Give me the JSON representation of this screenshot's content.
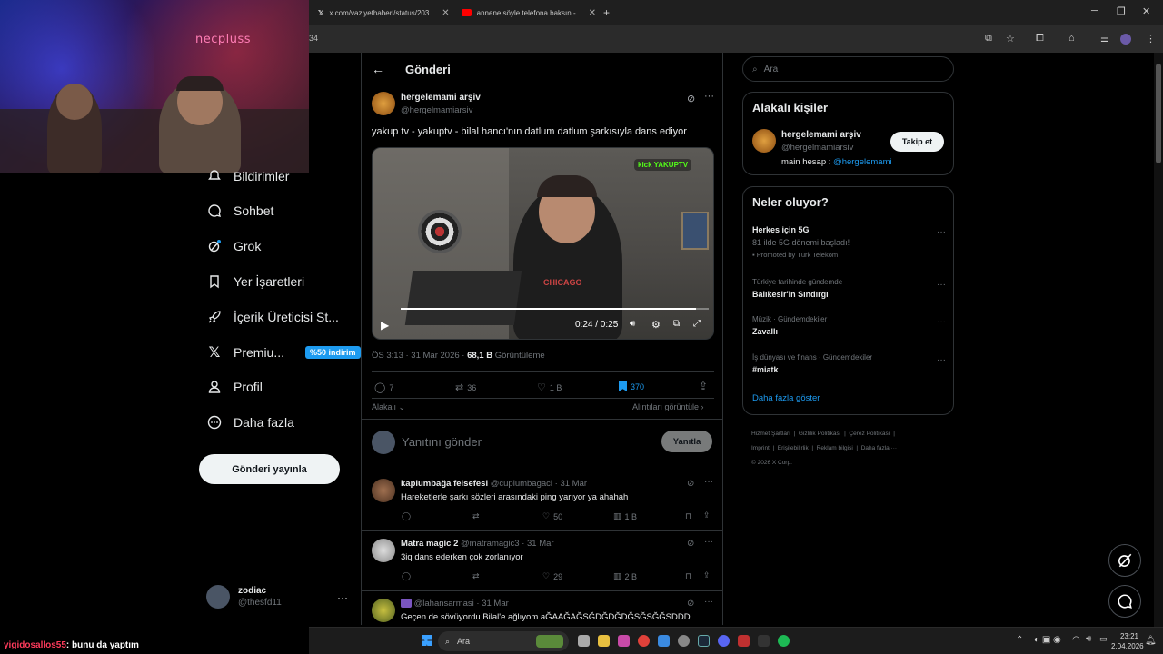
{
  "browser": {
    "tabs": [
      {
        "label": "x.com/vaziyethaberi/status/203"
      },
      {
        "label": "annene söyle telefona baksın -"
      }
    ],
    "address_fragment": "34"
  },
  "webcam": {
    "overlay_logo": "necpluss"
  },
  "sidebar": {
    "items": [
      {
        "label": "Bildirimler"
      },
      {
        "label": "Sohbet"
      },
      {
        "label": "Grok"
      },
      {
        "label": "Yer İşaretleri"
      },
      {
        "label": "İçerik Üreticisi St..."
      },
      {
        "label": "Premiu...",
        "badge": "%50 indirim"
      },
      {
        "label": "Profil"
      },
      {
        "label": "Daha fazla"
      }
    ],
    "post_button": "Gönderi yayınla",
    "account": {
      "name": "zodiac",
      "handle": "@thesfd11",
      "more": "···"
    }
  },
  "main": {
    "header_title": "Gönderi",
    "tweet": {
      "author_name": "hergelemami arşiv",
      "author_handle": "@hergelmamiarsiv",
      "text": "yakup tv - yakuptv - bilal hancı'nın datlum datlum şarkısıyla dans ediyor",
      "video_time": "0:24 / 0:25",
      "video_progress": 0.96,
      "video_watermark": "kick YAKUPTV",
      "meta_time": "ÖS 3:13 · 31 Mar 2026 · ",
      "views_count": "68,1 B",
      "views_label": " Görüntüleme",
      "stats": {
        "replies": "7",
        "retweets": "36",
        "likes": "1 B",
        "bookmarks": "370"
      },
      "sort_label": "Alakalı",
      "quotes_link": "Alıntıları görüntüle"
    },
    "compose": {
      "placeholder": "Yanıtını gönder",
      "button": "Yanıtla"
    },
    "replies": [
      {
        "name": "kaplumbağa felsefesi",
        "handle": "@cuplumbagaci · 31 Mar",
        "text": "Hareketlerle şarkı sözleri arasındaki ping yarıyor ya ahahah",
        "likes": "50",
        "views": "1 B"
      },
      {
        "name": "Matra magic 2",
        "handle": "@matramagic3 · 31 Mar",
        "text": "3iq dans ederken çok zorlanıyor",
        "likes": "29",
        "views": "2 B"
      },
      {
        "name": "",
        "handle": "@lahansarmasi · 31 Mar",
        "text": "Geçen de sövüyordu Bilal'e ağlıyom aĞAAĞAĞSĞDĞDĞDĞSĞSĞĞSDDD",
        "likes": "",
        "views": ""
      }
    ]
  },
  "right": {
    "search_placeholder": "Ara",
    "related": {
      "title": "Alakalı kişiler",
      "name": "hergelemami arşiv",
      "handle": "@hergelmamiarsiv",
      "bio_prefix": "main hesap : ",
      "bio_link": "@hergelemami",
      "follow": "Takip et"
    },
    "trends": {
      "title": "Neler oluyor?",
      "items": [
        {
          "category": "Herkes için 5G",
          "title": "81 ilde 5G dönemi başladı!",
          "promo": "Promoted by Türk Telekom"
        },
        {
          "category": "Türkiye tarihinde gündemde",
          "title": "Balıkesir'in Sındırgı"
        },
        {
          "category": "Müzik · Gündemdekiler",
          "title": "Zavallı"
        },
        {
          "category": "İş dünyası ve finans · Gündemdekiler",
          "title": "#miatk"
        }
      ],
      "show_more": "Daha fazla göster"
    },
    "footer": [
      "Hizmet Şartları",
      "Gizlilik Politikası",
      "Çerez Politikası",
      "Imprint",
      "Erişilebilirlik",
      "Reklam bilgisi",
      "Daha fazla ···",
      "© 2026 X Corp."
    ]
  },
  "chat": {
    "user": "yigidosallos55",
    "message": ": bunu da yaptım"
  },
  "taskbar": {
    "search": "Ara",
    "time": "23:21",
    "date": "2.04.2026"
  },
  "colors": {
    "accent": "#1d9bf0",
    "bg": "#000000",
    "border": "#2f3336",
    "chat_user": "#ff3b5c"
  }
}
